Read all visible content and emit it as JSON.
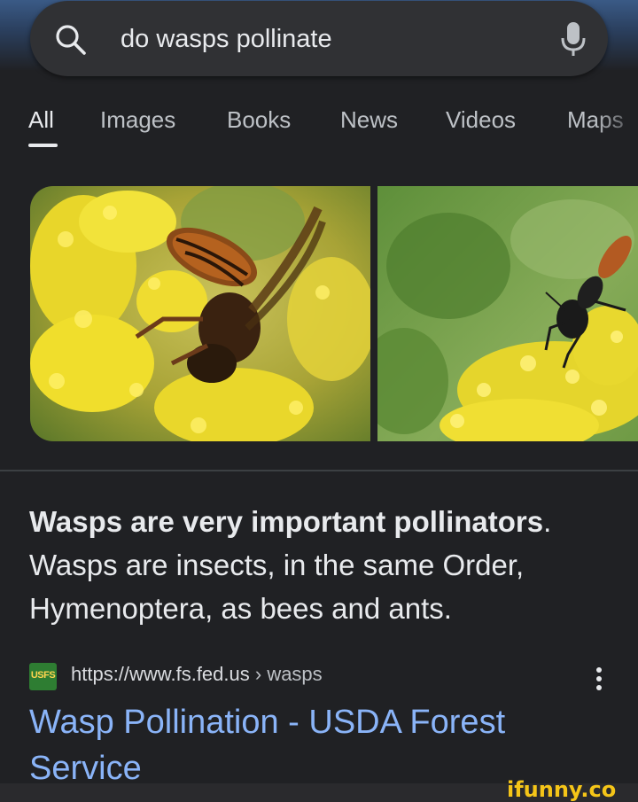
{
  "search": {
    "query": "do wasps pollinate",
    "search_icon": "search-icon",
    "mic_icon": "microphone-icon"
  },
  "tabs": [
    {
      "label": "All",
      "active": true
    },
    {
      "label": "Images"
    },
    {
      "label": "Books"
    },
    {
      "label": "News"
    },
    {
      "label": "Videos"
    },
    {
      "label": "Maps"
    }
  ],
  "images": [
    {
      "subject": "wasp on yellow goldenrod flower"
    },
    {
      "subject": "dark wasp on yellow goldenrod flowers"
    }
  ],
  "snippet": {
    "bold": "Wasps are very important pollinators",
    "period": ".",
    "text": " Wasps are insects, in the same Order, Hymenoptera, as bees and ants."
  },
  "result": {
    "favicon_text": "USFS",
    "url": "https://www.fs.fed.us",
    "separator": " › ",
    "breadcrumb": "wasps",
    "title": "Wasp Pollination - USDA Forest Service",
    "menu_icon": "more-vert-icon"
  },
  "watermark": {
    "text": "ifunny.co"
  },
  "colors": {
    "background": "#202124",
    "search_bar": "#303134",
    "link": "#8ab4f8",
    "text": "#e8eaed"
  }
}
